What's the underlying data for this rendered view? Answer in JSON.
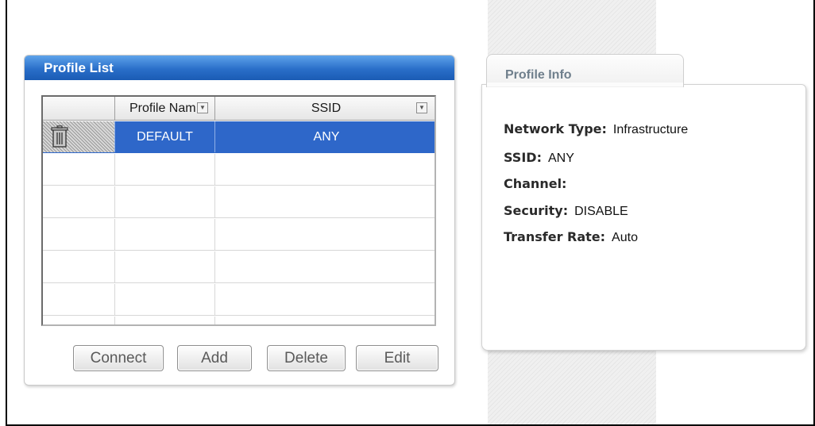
{
  "profile_list": {
    "title": "Profile List",
    "columns": [
      {
        "label": ""
      },
      {
        "label": "Profile Nam"
      },
      {
        "label": "SSID"
      }
    ],
    "rows": [
      {
        "icon": "trash-can-icon",
        "profile_name": "DEFAULT",
        "ssid": "ANY",
        "selected": true
      }
    ],
    "buttons": {
      "connect": "Connect",
      "add": "Add",
      "delete": "Delete",
      "edit": "Edit"
    }
  },
  "profile_info": {
    "tab_label": "Profile Info",
    "fields": [
      {
        "label": "Network Type:",
        "value": "Infrastructure"
      },
      {
        "label": "SSID:",
        "value": "ANY"
      },
      {
        "label": "Channel:",
        "value": ""
      },
      {
        "label": "Security:",
        "value": "DISABLE"
      },
      {
        "label": "Transfer Rate:",
        "value": "Auto"
      }
    ]
  },
  "colors": {
    "title_bar_blue": "#2a6fc9",
    "selection_blue": "#2e67c9",
    "info_tab_text": "#6f7f8c"
  }
}
